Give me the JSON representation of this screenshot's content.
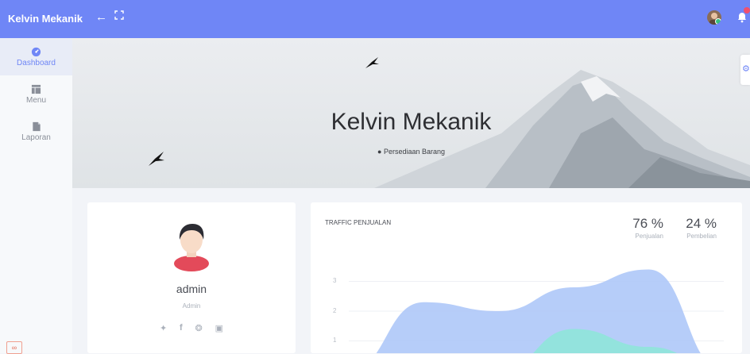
{
  "topbar": {
    "brand": "Kelvin Mekanik",
    "back_icon": "arrow-left-icon",
    "expand_icon": "fullscreen-icon",
    "notification_count": ""
  },
  "sidebar": {
    "items": [
      {
        "label": "Dashboard",
        "icon": "dashboard-icon",
        "active": true
      },
      {
        "label": "Menu",
        "icon": "table-icon",
        "active": false
      },
      {
        "label": "Laporan",
        "icon": "file-icon",
        "active": false
      }
    ]
  },
  "hero": {
    "title": "Kelvin Mekanik",
    "subtitle": "Persediaan Barang",
    "location_icon": "map-marker-icon"
  },
  "profile": {
    "name": "admin",
    "role": "Admin",
    "socials": [
      "twitter-icon",
      "facebook-icon",
      "dribbble-icon",
      "instagram-icon"
    ]
  },
  "traffic": {
    "title": "TRAFFIC PENJUALAN",
    "stats": [
      {
        "value": "76 %",
        "label": "Penjualan"
      },
      {
        "value": "24 %",
        "label": "Pembelian"
      }
    ],
    "y_ticks": [
      "3",
      "2",
      "1"
    ]
  },
  "chart_data": {
    "type": "area",
    "ylim": [
      0,
      4
    ],
    "series": [
      {
        "name": "Penjualan",
        "color": "#aec8f8",
        "points": [
          [
            0,
            0.0
          ],
          [
            1,
            2.3
          ],
          [
            2,
            2.0
          ],
          [
            3,
            2.8
          ],
          [
            4,
            3.4
          ],
          [
            5,
            0.0
          ]
        ]
      },
      {
        "name": "Pembelian",
        "color": "#8fe6d9",
        "points": [
          [
            0,
            0.0
          ],
          [
            1,
            0.3
          ],
          [
            2,
            0.0
          ],
          [
            3,
            1.4
          ],
          [
            4,
            0.8
          ],
          [
            5,
            0.0
          ]
        ]
      }
    ]
  },
  "colors": {
    "primary": "#6f86f6",
    "text": "#4a4d55",
    "muted": "#aab0ba"
  }
}
